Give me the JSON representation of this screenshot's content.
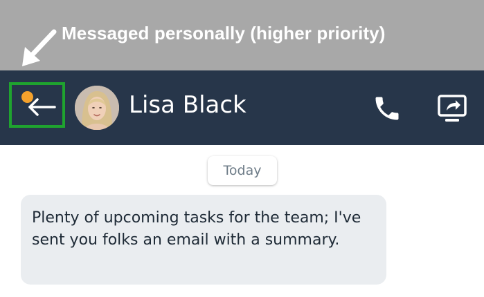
{
  "annotation": {
    "text": "Messaged personally (higher priority)"
  },
  "header": {
    "back_icon": "arrow-left-icon",
    "notification_dot_color": "#f4a12c",
    "contact_name": "Lisa Black",
    "call_icon": "phone-icon",
    "share_icon": "screen-share-icon",
    "background_color": "#27364a",
    "highlight_color": "#1fa32f"
  },
  "conversation": {
    "date_label": "Today",
    "messages": [
      {
        "text": "Plenty of upcoming tasks for the team; I've sent you folks an email with a summary."
      }
    ]
  }
}
